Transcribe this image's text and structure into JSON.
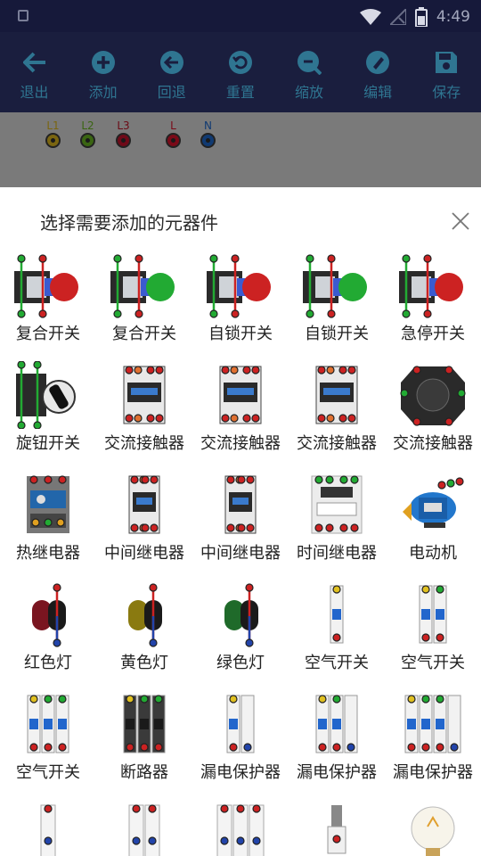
{
  "statusbar": {
    "time": "4:49"
  },
  "toolbar": {
    "items": [
      {
        "label": "退出",
        "icon": "arrow-left-icon"
      },
      {
        "label": "添加",
        "icon": "plus-circle-icon"
      },
      {
        "label": "回退",
        "icon": "back-circle-icon"
      },
      {
        "label": "重置",
        "icon": "reset-circle-icon"
      },
      {
        "label": "缩放",
        "icon": "zoom-out-circle-icon"
      },
      {
        "label": "编辑",
        "icon": "edit-circle-icon"
      },
      {
        "label": "保存",
        "icon": "save-icon"
      }
    ]
  },
  "terminals": [
    {
      "label": "L1",
      "color": "#c8a21a",
      "text_color": "#d4a017"
    },
    {
      "label": "L2",
      "color": "#5aa01e",
      "text_color": "#5aa01e"
    },
    {
      "label": "L3",
      "color": "#b0102a",
      "text_color": "#a0101e"
    },
    {
      "label": "L",
      "color": "#d0102a",
      "text_color": "#d0102a"
    },
    {
      "label": "N",
      "color": "#1a5ab0",
      "text_color": "#1a5ab0"
    }
  ],
  "sheet": {
    "title": "选择需要添加的元器件",
    "components": [
      {
        "label": "复合开关",
        "icon": "compound-switch-red-icon",
        "accent": "#cc2222"
      },
      {
        "label": "复合开关",
        "icon": "compound-switch-green-icon",
        "accent": "#22aa33"
      },
      {
        "label": "自锁开关",
        "icon": "latch-switch-red-icon",
        "accent": "#cc2222"
      },
      {
        "label": "自锁开关",
        "icon": "latch-switch-green-icon",
        "accent": "#22aa33"
      },
      {
        "label": "急停开关",
        "icon": "emergency-stop-icon",
        "accent": "#cc2222"
      },
      {
        "label": "旋钮开关",
        "icon": "rotary-switch-icon",
        "accent": "#222222"
      },
      {
        "label": "交流接触器",
        "icon": "ac-contactor-icon",
        "accent": "#333333"
      },
      {
        "label": "交流接触器",
        "icon": "ac-contactor-icon",
        "accent": "#333333"
      },
      {
        "label": "交流接触器",
        "icon": "ac-contactor-icon",
        "accent": "#333333"
      },
      {
        "label": "交流接触器",
        "icon": "ac-contactor-round-icon",
        "accent": "#333333"
      },
      {
        "label": "热继电器",
        "icon": "thermal-relay-icon",
        "accent": "#2266aa"
      },
      {
        "label": "中间继电器",
        "icon": "intermediate-relay-icon",
        "accent": "#333333"
      },
      {
        "label": "中间继电器",
        "icon": "intermediate-relay-icon",
        "accent": "#333333"
      },
      {
        "label": "时间继电器",
        "icon": "time-relay-icon",
        "accent": "#dddddd"
      },
      {
        "label": "电动机",
        "icon": "motor-icon",
        "accent": "#2277cc"
      },
      {
        "label": "红色灯",
        "icon": "red-lamp-icon",
        "accent": "#7a1520"
      },
      {
        "label": "黄色灯",
        "icon": "yellow-lamp-icon",
        "accent": "#8a7a10"
      },
      {
        "label": "绿色灯",
        "icon": "green-lamp-icon",
        "accent": "#1f6a2a"
      },
      {
        "label": "空气开关",
        "icon": "air-switch-1p-icon",
        "accent": "#2266cc"
      },
      {
        "label": "空气开关",
        "icon": "air-switch-2p-icon",
        "accent": "#2266cc"
      },
      {
        "label": "空气开关",
        "icon": "air-switch-3p-icon",
        "accent": "#2266cc"
      },
      {
        "label": "断路器",
        "icon": "circuit-breaker-icon",
        "accent": "#333333"
      },
      {
        "label": "漏电保护器",
        "icon": "leakage-protector-1p-icon",
        "accent": "#2266cc"
      },
      {
        "label": "漏电保护器",
        "icon": "leakage-protector-2p-icon",
        "accent": "#2266cc"
      },
      {
        "label": "漏电保护器",
        "icon": "leakage-protector-3p-icon",
        "accent": "#2266cc"
      },
      {
        "label": "",
        "icon": "fuse-1p-icon",
        "accent": "#cc2222"
      },
      {
        "label": "",
        "icon": "fuse-2p-icon",
        "accent": "#cc2222"
      },
      {
        "label": "",
        "icon": "fuse-3p-icon",
        "accent": "#cc2222"
      },
      {
        "label": "",
        "icon": "socket-icon",
        "accent": "#cc2222"
      },
      {
        "label": "",
        "icon": "bulb-icon",
        "accent": "#f0c060"
      }
    ]
  }
}
